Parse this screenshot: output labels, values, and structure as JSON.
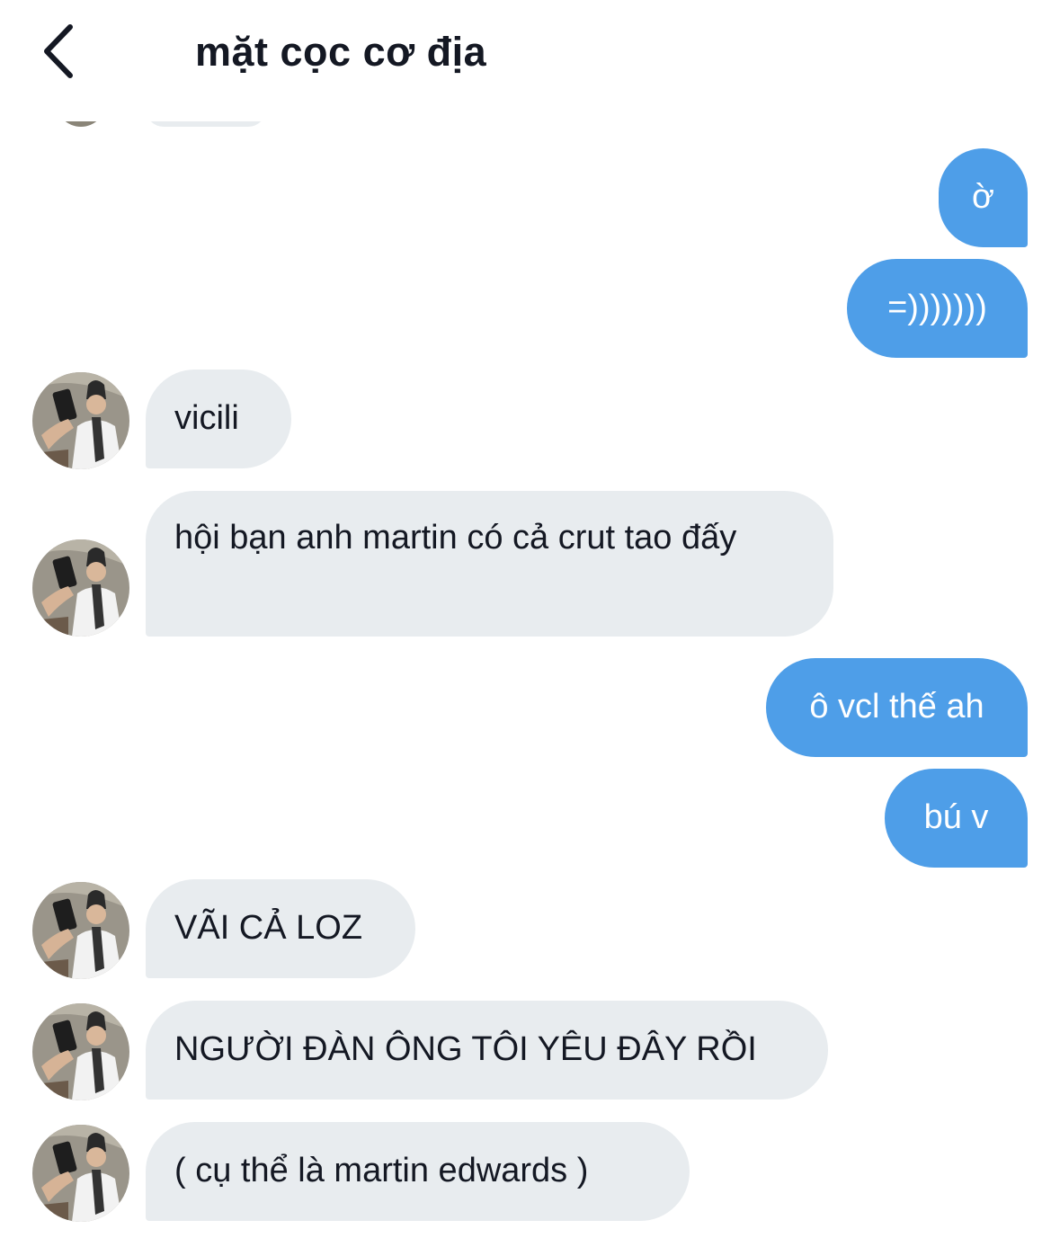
{
  "header": {
    "title": "mặt cọc cơ địa",
    "back_icon": "chevron-left-icon"
  },
  "colors": {
    "outgoing_bubble": "#4e9ee8",
    "incoming_bubble": "#e8ecef",
    "text_dark": "#141823",
    "text_light": "#ffffff"
  },
  "messages": [
    {
      "direction": "out",
      "text": "ờ"
    },
    {
      "direction": "out",
      "text": "=)))))))"
    },
    {
      "direction": "in",
      "text": "vicili"
    },
    {
      "direction": "in",
      "text": "hội bạn anh martin có cả crut tao đấy"
    },
    {
      "direction": "out",
      "text": "ô vcl thế ah"
    },
    {
      "direction": "out",
      "text": "bú v"
    },
    {
      "direction": "in",
      "text": "VÃI CẢ LOZ"
    },
    {
      "direction": "in",
      "text": "NGƯỜI ĐÀN ÔNG TÔI YÊU ĐÂY RỒI"
    },
    {
      "direction": "in",
      "text": "( cụ thể là martin edwards )"
    }
  ]
}
